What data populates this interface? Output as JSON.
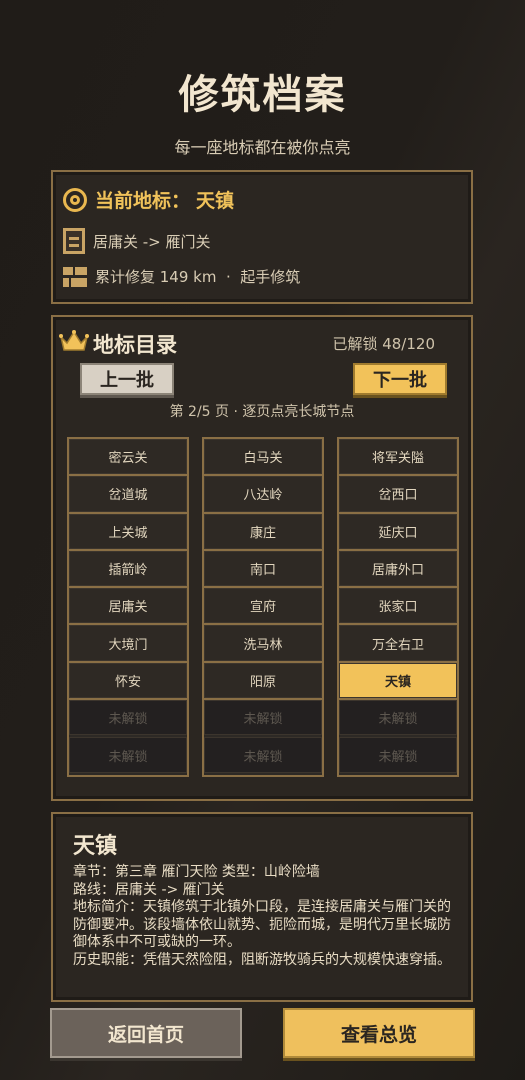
{
  "header": {
    "title": "修筑档案",
    "subtitle": "每一座地标都在被你点亮"
  },
  "current": {
    "label": "当前地标：",
    "name": "天镇",
    "route": "居庸关 -> 雁门关",
    "progress": "累计修复 149 km  ·  起手修筑"
  },
  "catalog": {
    "title": "地标目录",
    "unlocked": "已解锁 48/120",
    "prev_label": "上一批",
    "next_label": "下一批",
    "page_info": "第 2/5 页 · 逐页点亮长城节点",
    "columns": [
      [
        "密云关",
        "岔道城",
        "上关城",
        "插箭岭",
        "居庸关",
        "大境门",
        "怀安",
        "未解锁",
        "未解锁"
      ],
      [
        "白马关",
        "八达岭",
        "康庄",
        "南口",
        "宣府",
        "洗马林",
        "阳原",
        "未解锁",
        "未解锁"
      ],
      [
        "将军关隘",
        "岔西口",
        "延庆口",
        "居庸外口",
        "张家口",
        "万全右卫",
        "天镇",
        "未解锁",
        "未解锁"
      ]
    ],
    "active_cell": "天镇",
    "locked_label": "未解锁"
  },
  "detail": {
    "name": "天镇",
    "chapter": "章节：第三章 雁门天险 类型：山岭险墙",
    "route": "路线：居庸关 -> 雁门关",
    "intro": "地标简介：天镇修筑于北镇外口段，是连接居庸关与雁门关的防御要冲。该段墙体依山就势、扼险而城，是明代万里长城防御体系中不可或缺的一环。",
    "role": "历史职能：凭借天然险阻，阻断游牧骑兵的大规模快速穿插。"
  },
  "footer": {
    "home_label": "返回首页",
    "overview_label": "查看总览"
  },
  "colors": {
    "accent": "#f2c25a",
    "panel_border": "#8a6f45",
    "background": "#1c1916"
  }
}
